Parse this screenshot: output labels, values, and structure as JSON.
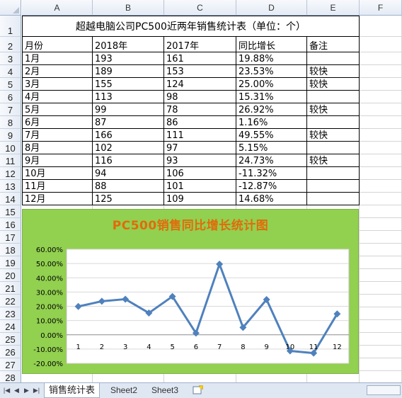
{
  "columns": [
    "A",
    "B",
    "C",
    "D",
    "E",
    "F"
  ],
  "rows": [
    "1",
    "2",
    "3",
    "4",
    "5",
    "6",
    "7",
    "8",
    "9",
    "10",
    "11",
    "12",
    "13",
    "14",
    "15",
    "16",
    "17",
    "18",
    "19",
    "20",
    "21",
    "22",
    "23",
    "24",
    "25",
    "26",
    "27",
    "28"
  ],
  "table": {
    "title": "超越电脑公司PC500近两年销售统计表（单位：个）",
    "headers": [
      "月份",
      "2018年",
      "2017年",
      "同比增长",
      "备注"
    ],
    "rows": [
      [
        "1月",
        "193",
        "161",
        "19.88%",
        ""
      ],
      [
        "2月",
        "189",
        "153",
        "23.53%",
        "较快"
      ],
      [
        "3月",
        "155",
        "124",
        "25.00%",
        "较快"
      ],
      [
        "4月",
        "113",
        "98",
        "15.31%",
        ""
      ],
      [
        "5月",
        "99",
        "78",
        "26.92%",
        "较快"
      ],
      [
        "6月",
        "87",
        "86",
        "1.16%",
        ""
      ],
      [
        "7月",
        "166",
        "111",
        "49.55%",
        "较快"
      ],
      [
        "8月",
        "102",
        "97",
        "5.15%",
        ""
      ],
      [
        "9月",
        "116",
        "93",
        "24.73%",
        "较快"
      ],
      [
        "10月",
        "94",
        "106",
        "-11.32%",
        ""
      ],
      [
        "11月",
        "88",
        "101",
        "-12.87%",
        ""
      ],
      [
        "12月",
        "125",
        "109",
        "14.68%",
        ""
      ]
    ]
  },
  "chart_data": {
    "type": "line",
    "title": "PC500销售同比增长统计图",
    "categories": [
      "1",
      "2",
      "3",
      "4",
      "5",
      "6",
      "7",
      "8",
      "9",
      "10",
      "11",
      "12"
    ],
    "values": [
      19.88,
      23.53,
      25.0,
      15.31,
      26.92,
      1.16,
      49.55,
      5.15,
      24.73,
      -11.32,
      -12.87,
      14.68
    ],
    "ylim": [
      -20,
      60
    ],
    "yticks": [
      60,
      50,
      40,
      30,
      20,
      10,
      0,
      -10,
      -20
    ],
    "ytick_labels": [
      "60.00%",
      "50.00%",
      "40.00%",
      "30.00%",
      "20.00%",
      "10.00%",
      "0.00%",
      "-10.00%",
      "-20.00%"
    ],
    "grid": true,
    "line_color": "#4f81bd",
    "background_color": "#92d050",
    "title_color": "#e26b0a"
  },
  "tabs": {
    "items": [
      "销售统计表",
      "Sheet2",
      "Sheet3"
    ],
    "active_index": 0,
    "nav": [
      "|◀",
      "◀",
      "▶",
      "▶|"
    ]
  }
}
